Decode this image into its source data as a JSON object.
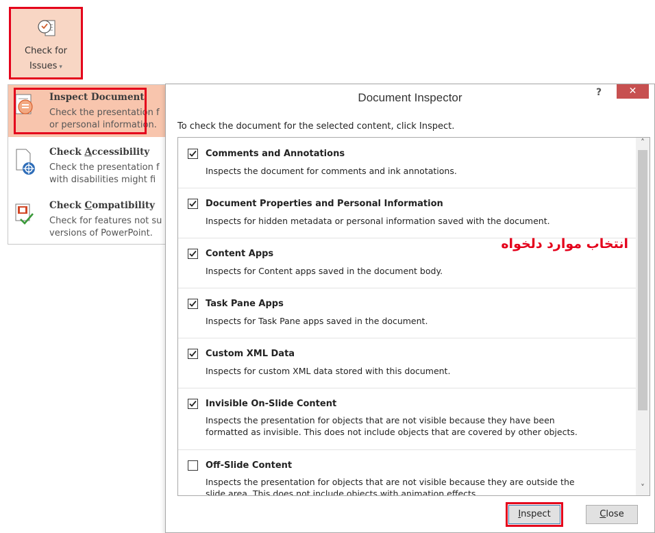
{
  "ribbon": {
    "button_line1": "Check for",
    "button_line2": "Issues",
    "caret": "▾"
  },
  "menu": {
    "items": [
      {
        "title": "Inspect Document",
        "desc": "Check the presentation f\nor personal information.",
        "icon": "inspect-document-icon"
      },
      {
        "title_pre": "Check ",
        "title_accel": "A",
        "title_post": "ccessibility",
        "desc": "Check the presentation f\nwith disabilities might fi",
        "icon": "accessibility-icon"
      },
      {
        "title_pre": "Check ",
        "title_accel": "C",
        "title_post": "ompatibility",
        "desc": "Check for features not su\nversions of PowerPoint.",
        "icon": "compatibility-icon"
      }
    ]
  },
  "dialog": {
    "title": "Document Inspector",
    "help": "?",
    "close": "✕",
    "instruction": "To check the document for the selected content, click Inspect.",
    "items": [
      {
        "title": "Comments and Annotations",
        "desc": "Inspects the document for comments and ink annotations.",
        "checked": true
      },
      {
        "title": "Document Properties and Personal Information",
        "desc": "Inspects for hidden metadata or personal information saved with the document.",
        "checked": true
      },
      {
        "title": "Content Apps",
        "desc": "Inspects for Content apps saved in the document body.",
        "checked": true
      },
      {
        "title": "Task Pane Apps",
        "desc": "Inspects for Task Pane apps saved in the document.",
        "checked": true
      },
      {
        "title": "Custom XML Data",
        "desc": "Inspects for custom XML data stored with this document.",
        "checked": true
      },
      {
        "title": "Invisible On-Slide Content",
        "desc": "Inspects the presentation for objects that are not visible because they have been\nformatted as invisible. This does not include objects that are covered by other objects.",
        "checked": true
      },
      {
        "title": "Off-Slide Content",
        "desc": "Inspects the presentation for objects that are not visible because they are outside the\nslide area. This does not include objects with animation effects.",
        "checked": false
      }
    ],
    "annotation": "انتخاب موارد دلخواه",
    "inspect_accel": "I",
    "inspect_rest": "nspect",
    "close_accel": "C",
    "close_rest": "lose",
    "scroll_up": "˄",
    "scroll_down": "˅"
  },
  "colors": {
    "highlight": "#e4001b",
    "ribbon_selected": "#f8d6c4",
    "menu_selected": "#f8c5ad",
    "close_button": "#c75050"
  }
}
